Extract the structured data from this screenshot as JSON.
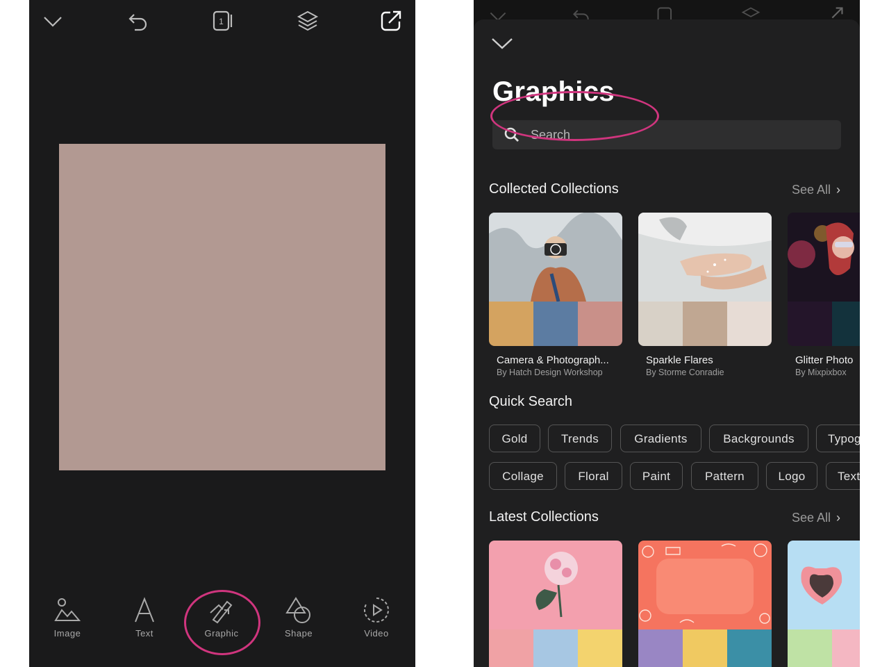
{
  "editor": {
    "toolbar": {
      "collapse_icon": "chevron-down-icon",
      "undo_icon": "undo-icon",
      "pages_icon": "pages-icon",
      "pages_count": "1",
      "layers_icon": "layers-icon",
      "share_icon": "share-icon"
    },
    "canvas_color": "#b29992",
    "tools": [
      {
        "label": "Image",
        "icon": "image-icon"
      },
      {
        "label": "Text",
        "icon": "text-icon"
      },
      {
        "label": "Graphic",
        "icon": "graphic-icon"
      },
      {
        "label": "Shape",
        "icon": "shape-icon"
      },
      {
        "label": "Video",
        "icon": "video-icon"
      }
    ],
    "highlight_color": "#d0357e"
  },
  "graphics": {
    "title": "Graphics",
    "search": {
      "placeholder": "Search"
    },
    "collected": {
      "title": "Collected Collections",
      "see_all": "See All",
      "items": [
        {
          "title": "Camera & Photograph...",
          "author": "By Hatch Design Workshop"
        },
        {
          "title": "Sparkle Flares",
          "author": "By Storme Conradie"
        },
        {
          "title": "Glitter Photo",
          "author": "By Mixpixbox"
        }
      ]
    },
    "quick_search": {
      "title": "Quick Search",
      "row1": [
        "Gold",
        "Trends",
        "Gradients",
        "Backgrounds",
        "Typog"
      ],
      "row2": [
        "Collage",
        "Floral",
        "Paint",
        "Pattern",
        "Logo",
        "Text"
      ]
    },
    "latest": {
      "title": "Latest Collections",
      "see_all": "See All"
    }
  }
}
